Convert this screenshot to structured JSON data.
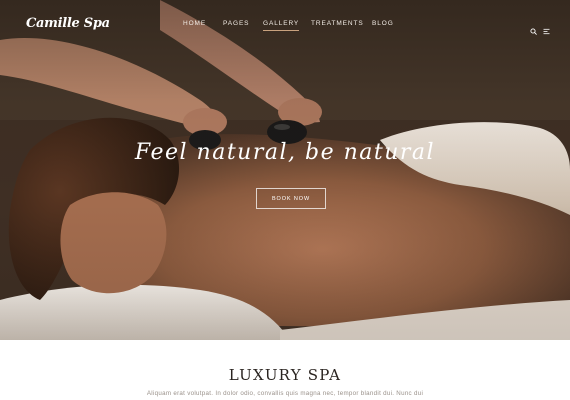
{
  "header": {
    "logo_text": "Camille Spa",
    "nav": [
      {
        "label": "HOME",
        "active": false
      },
      {
        "label": "PAGES",
        "active": false
      },
      {
        "label": "GALLERY",
        "active": true
      },
      {
        "label": "TREATMENTS",
        "active": false
      },
      {
        "label": "BLOG",
        "active": false
      }
    ],
    "icons": [
      "search-icon",
      "menu-icon"
    ]
  },
  "hero": {
    "title": "Feel natural, be natural",
    "button_label": "BOOK NOW",
    "image_subject": "hot stone massage"
  },
  "section": {
    "title": "LUXURY SPA",
    "text": "Aliquam erat volutpat. In dolor odio, convallis quis magna nec, tempor blandit dui. Nunc dui"
  },
  "colors": {
    "nav_active_underline": "#c9a27e",
    "hero_text": "#ffffff",
    "section_title": "#2a2420",
    "section_text": "#9a918a"
  }
}
